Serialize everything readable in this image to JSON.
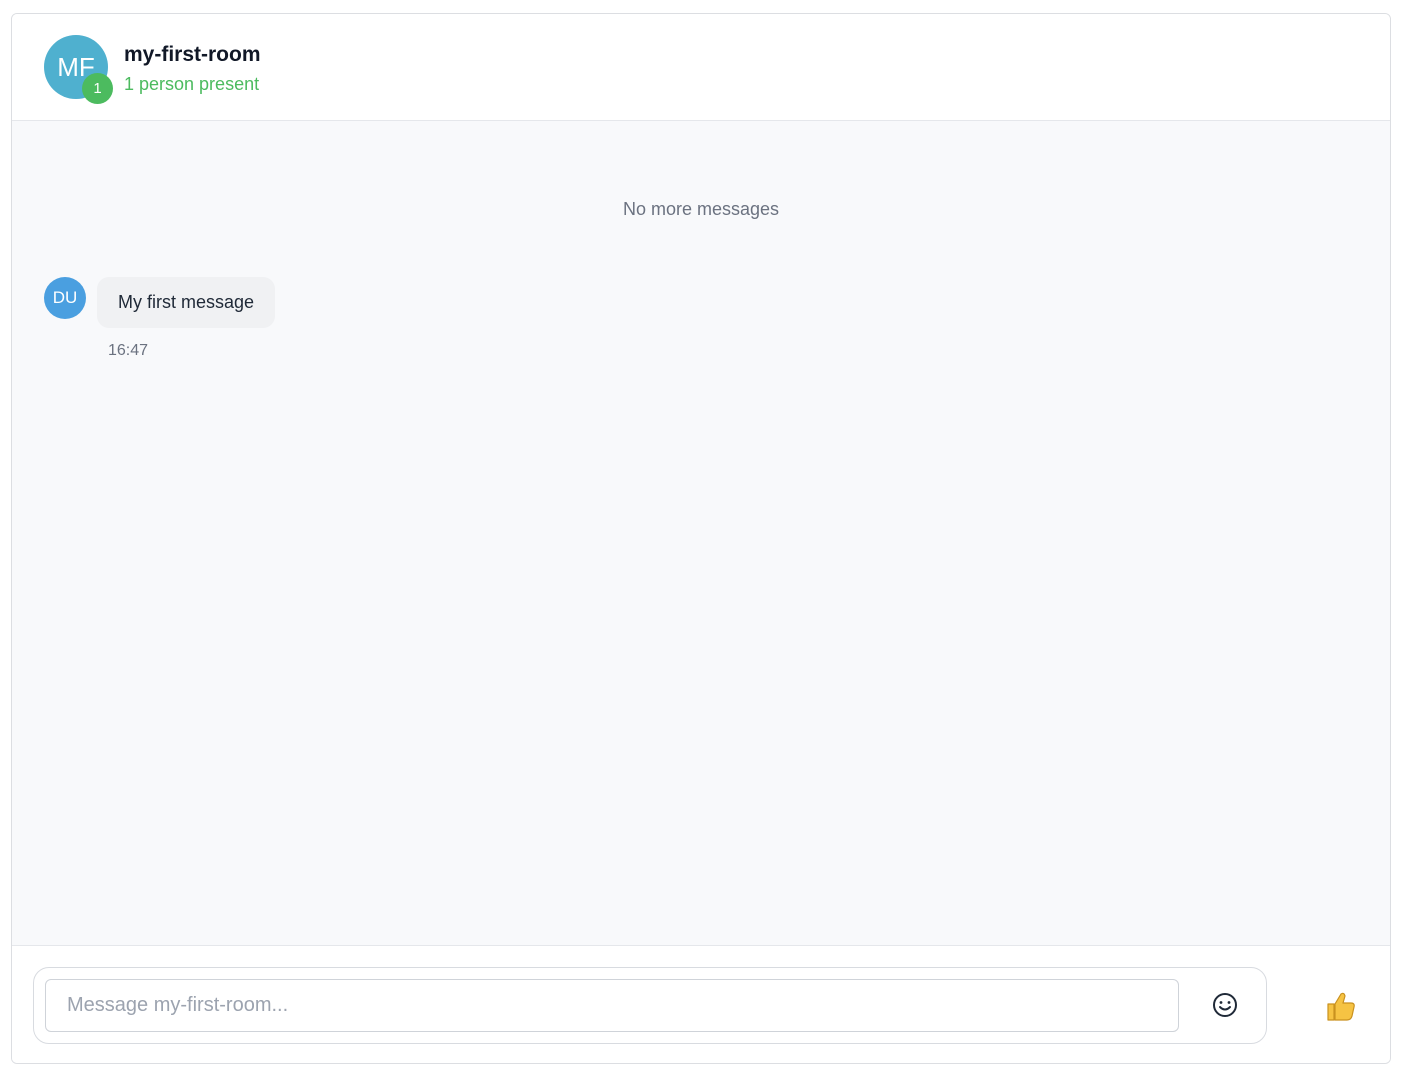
{
  "colors": {
    "room_avatar_bg": "#4fb0cf",
    "presence_green": "#4cbb5f",
    "user_avatar_bg": "#4a9fe0",
    "thumb_yellow": "#f6c343"
  },
  "header": {
    "avatar_initials": "MF",
    "presence_count": "1",
    "room_name": "my-first-room",
    "presence_text": "1 person present"
  },
  "messages": {
    "no_more_label": "No more messages",
    "items": [
      {
        "author_initials": "DU",
        "text": "My first message",
        "time": "16:47"
      }
    ]
  },
  "composer": {
    "placeholder": "Message my-first-room...",
    "value": "",
    "emoji_icon": "smiley-face-icon",
    "like_icon": "thumbs-up-icon"
  }
}
